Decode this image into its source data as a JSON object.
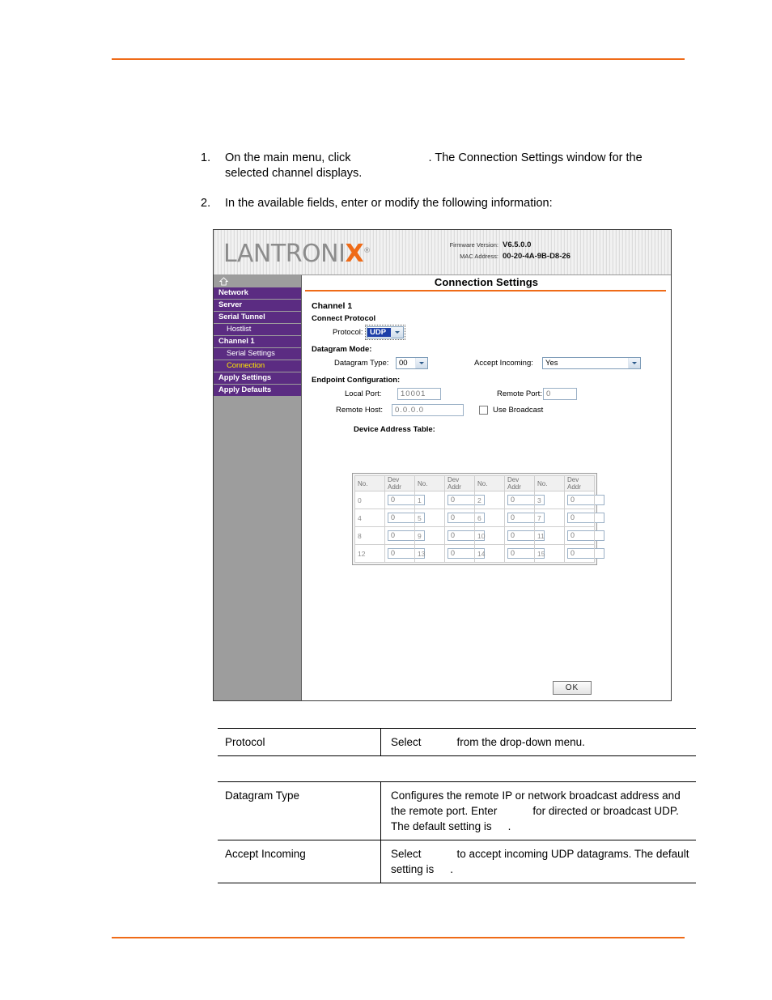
{
  "steps": [
    {
      "num": "1.",
      "pre": "On the main menu, click",
      "post": ". The Connection Settings window for the selected channel displays."
    },
    {
      "num": "2.",
      "pre": "In the available fields, enter or modify the following information:",
      "post": ""
    }
  ],
  "screenshot": {
    "header": {
      "logo_text": "LANTRONI",
      "logo_x": "X",
      "registered_mark": "®",
      "firmware_label": "Firmware Version:",
      "firmware_value": "V6.5.0.0",
      "mac_label": "MAC Address:",
      "mac_value": "00-20-4A-9B-D8-26"
    },
    "sidebar": {
      "home_icon": "home-icon",
      "items": [
        {
          "label": "Network",
          "level": "top",
          "state": "normal"
        },
        {
          "label": "Server",
          "level": "top",
          "state": "normal"
        },
        {
          "label": "Serial Tunnel",
          "level": "top",
          "state": "normal"
        },
        {
          "label": "Hostlist",
          "level": "sub",
          "state": "normal"
        },
        {
          "label": "Channel 1",
          "level": "top",
          "state": "normal"
        },
        {
          "label": "Serial Settings",
          "level": "sub",
          "state": "normal"
        },
        {
          "label": "Connection",
          "level": "sub",
          "state": "active"
        },
        {
          "label": "Apply Settings",
          "level": "top",
          "state": "normal"
        },
        {
          "label": "Apply Defaults",
          "level": "top",
          "state": "normal"
        }
      ]
    },
    "page_title": "Connection Settings",
    "form": {
      "channel_heading": "Channel 1",
      "connect_protocol_heading": "Connect Protocol",
      "protocol_label": "Protocol:",
      "protocol_value": "UDP",
      "datagram_mode_heading": "Datagram Mode:",
      "datagram_type_label": "Datagram Type:",
      "datagram_type_value": "00",
      "accept_incoming_label": "Accept Incoming:",
      "accept_incoming_value": "Yes",
      "endpoint_heading": "Endpoint Configuration:",
      "local_port_label": "Local Port:",
      "local_port_value": "10001",
      "remote_port_label": "Remote Port:",
      "remote_port_value": "0",
      "remote_host_label": "Remote Host:",
      "remote_host_value": "0.0.0.0",
      "use_broadcast_label": "Use Broadcast",
      "use_broadcast_checked": false,
      "device_address_table_caption": "Device Address Table:",
      "table_headers": [
        "No.",
        "Dev Addr",
        "No.",
        "Dev Addr",
        "No.",
        "Dev Addr",
        "No.",
        "Dev Addr"
      ],
      "table_rows": [
        [
          {
            "no": "0",
            "addr": "0"
          },
          {
            "no": "1",
            "addr": "0"
          },
          {
            "no": "2",
            "addr": "0"
          },
          {
            "no": "3",
            "addr": "0"
          }
        ],
        [
          {
            "no": "4",
            "addr": "0"
          },
          {
            "no": "5",
            "addr": "0"
          },
          {
            "no": "6",
            "addr": "0"
          },
          {
            "no": "7",
            "addr": "0"
          }
        ],
        [
          {
            "no": "8",
            "addr": "0"
          },
          {
            "no": "9",
            "addr": "0"
          },
          {
            "no": "10",
            "addr": "0"
          },
          {
            "no": "11",
            "addr": "0"
          }
        ],
        [
          {
            "no": "12",
            "addr": "0"
          },
          {
            "no": "13",
            "addr": "0"
          },
          {
            "no": "14",
            "addr": "0"
          },
          {
            "no": "15",
            "addr": "0"
          }
        ]
      ],
      "ok_button": "OK"
    }
  },
  "desc_protocol": {
    "row": {
      "name": "Protocol",
      "text_a": "Select",
      "text_b": "from the drop-down menu."
    }
  },
  "desc_settings": {
    "rows": [
      {
        "name": "Datagram Type",
        "text_a": "Configures the remote IP or network broadcast address and the remote port. Enter",
        "text_b": "for directed or broadcast UDP. The default setting is",
        "text_c": "."
      },
      {
        "name": "Accept Incoming",
        "text_a": "Select",
        "text_b": "to accept incoming UDP datagrams. The default setting is",
        "text_c": "."
      }
    ]
  },
  "colors": {
    "accent_orange": "#ef6b18",
    "menu_purple": "#5b2c82",
    "active_yellow": "#ffe600",
    "sidebar_gray": "#9d9d9d"
  }
}
